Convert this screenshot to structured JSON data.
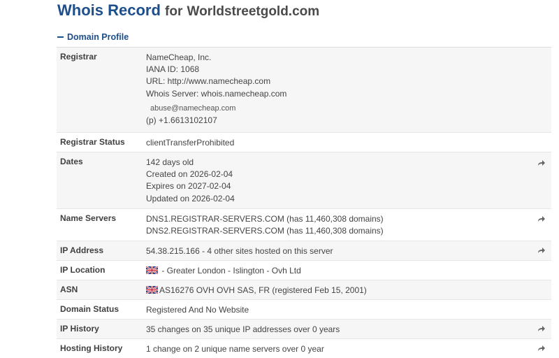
{
  "header": {
    "title_prefix": "Whois Record",
    "title_for": "for",
    "domain": "Worldstreetgold.com"
  },
  "section": {
    "label": "Domain Profile",
    "icon": "minus-icon"
  },
  "registrar": {
    "label": "Registrar",
    "name": "NameCheap, Inc.",
    "iana": "IANA ID: 1068",
    "url": "URL: http://www.namecheap.com",
    "whois_server": "Whois Server: whois.namecheap.com",
    "email": "abuse@namecheap.com",
    "phone": "(p)  +1.6613102107"
  },
  "registrar_status": {
    "label": "Registrar Status",
    "value": "clientTransferProhibited"
  },
  "dates": {
    "label": "Dates",
    "age": "142 days old",
    "created": "Created on 2026-02-04",
    "expires": "Expires on 2027-02-04",
    "updated": "Updated on 2026-02-04"
  },
  "name_servers": {
    "label": "Name Servers",
    "ns1": "DNS1.REGISTRAR-SERVERS.COM (has 11,460,308 domains)",
    "ns2": "DNS2.REGISTRAR-SERVERS.COM (has 11,460,308 domains)"
  },
  "ip_address": {
    "label": "IP Address",
    "value": "54.38.215.166 - 4 other sites hosted on this server"
  },
  "ip_location": {
    "label": "IP Location",
    "value": " - Greater London - Islington - Ovh Ltd",
    "flag": "uk-flag-icon"
  },
  "asn": {
    "label": "ASN",
    "value": "AS16276 OVH OVH SAS, FR (registered Feb 15, 2001)",
    "flag": "uk-flag-icon"
  },
  "domain_status": {
    "label": "Domain Status",
    "value": "Registered And No Website"
  },
  "ip_history": {
    "label": "IP History",
    "value": "35 changes on 35 unique IP addresses over 0 years"
  },
  "hosting_history": {
    "label": "Hosting History",
    "value": "1 change on 2 unique name servers over 0 year"
  },
  "colors": {
    "title": "#1e4e8c",
    "row_alt": "#f6f6f6",
    "border": "#e6e6e6"
  }
}
